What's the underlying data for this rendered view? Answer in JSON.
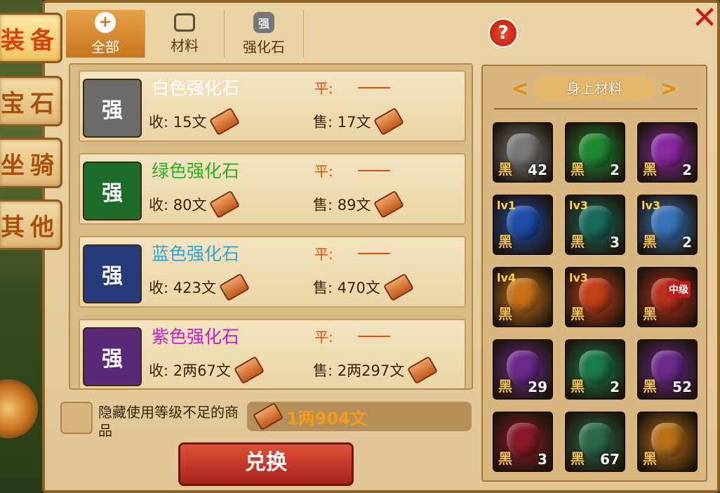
{
  "side_tabs": [
    {
      "label": "装备",
      "active": true
    },
    {
      "label": "宝石",
      "active": false
    },
    {
      "label": "坐骑",
      "active": false
    },
    {
      "label": "其他",
      "active": false
    }
  ],
  "top_tabs": [
    {
      "label": "全部",
      "icon": "plus-icon",
      "active": true
    },
    {
      "label": "材料",
      "icon": "layers-icon",
      "active": false
    },
    {
      "label": "强化石",
      "icon": "stone-icon",
      "active": false
    }
  ],
  "help_label": "?",
  "close_label": "✕",
  "items": [
    {
      "name": "白色强化石",
      "name_color": "#ffffff",
      "ping_label": "平:",
      "buy": "收: 15文",
      "sell": "售: 17文",
      "thumb_bg": "#6b6b6b",
      "glyph": "强"
    },
    {
      "name": "绿色强化石",
      "name_color": "#2bb026",
      "ping_label": "平:",
      "buy": "收: 80文",
      "sell": "售: 89文",
      "thumb_bg": "#1f6b2a",
      "glyph": "强"
    },
    {
      "name": "蓝色强化石",
      "name_color": "#2fa6d8",
      "ping_label": "平:",
      "buy": "收: 423文",
      "sell": "售: 470文",
      "thumb_bg": "#243a7a",
      "glyph": "强"
    },
    {
      "name": "紫色强化石",
      "name_color": "#c21fc8",
      "ping_label": "平:",
      "buy": "收: 2两67文",
      "sell": "售: 2两297文",
      "thumb_bg": "#5a2a78",
      "glyph": "强"
    }
  ],
  "hide_label": "隐藏使用等级不足的商品",
  "money": "1两904文",
  "exchange_label": "兑换",
  "right_panel": {
    "title": "身上材料",
    "left_arrow": "<",
    "right_arrow": ">",
    "cells": [
      {
        "lv": "",
        "tag": "黑",
        "count": "42",
        "color": "#7a7a7a"
      },
      {
        "lv": "",
        "tag": "黑",
        "count": "2",
        "color": "#1f8a35"
      },
      {
        "lv": "",
        "tag": "黑",
        "count": "2",
        "color": "#8a2aa0"
      },
      {
        "lv": "lv1",
        "tag": "黑",
        "count": "",
        "color": "#1e4ea8"
      },
      {
        "lv": "lv3",
        "tag": "黑",
        "count": "3",
        "color": "#1a6a5a"
      },
      {
        "lv": "lv3",
        "tag": "黑",
        "count": "2",
        "color": "#3a74b8"
      },
      {
        "lv": "lv4",
        "tag": "黑",
        "count": "",
        "color": "#c8721a"
      },
      {
        "lv": "lv3",
        "tag": "黑",
        "count": "",
        "color": "#c2401a"
      },
      {
        "lv": "",
        "tag": "黑",
        "count": "",
        "color": "#b8301c",
        "mid": "中级"
      },
      {
        "lv": "",
        "tag": "黑",
        "count": "29",
        "color": "#6a2a8a"
      },
      {
        "lv": "",
        "tag": "黑",
        "count": "2",
        "color": "#1c7a4a"
      },
      {
        "lv": "",
        "tag": "黑",
        "count": "52",
        "color": "#6a2a8a"
      },
      {
        "lv": "",
        "tag": "黑",
        "count": "3",
        "color": "#8a1a2a"
      },
      {
        "lv": "",
        "tag": "黑",
        "count": "67",
        "color": "#2a6a4a"
      },
      {
        "lv": "",
        "tag": "黑",
        "count": "",
        "color": "#b8701a"
      }
    ]
  }
}
